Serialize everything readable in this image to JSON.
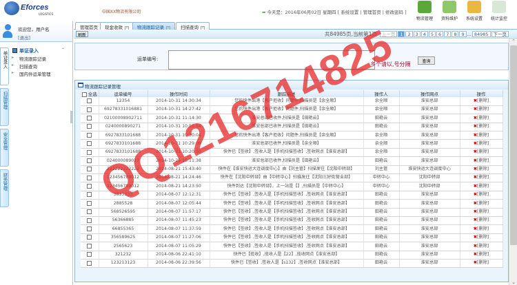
{
  "header": {
    "logo_text": "Eforces",
    "logo_sub": "LOGISTICS",
    "company": "中国XX物流有限公司",
    "date_text": "今天是：2016年06月02日 星期四",
    "links": [
      "系统设置",
      "管理首页",
      "修改密码"
    ],
    "modules": [
      {
        "label": "物流管理",
        "color": "#5aa83a"
      },
      {
        "label": "资料维护",
        "color": "#8fc86a"
      },
      {
        "label": "系统设置",
        "color": "#e8b840"
      },
      {
        "label": "统计监控",
        "color": "#d8e8d8"
      }
    ]
  },
  "user": {
    "welcome": "欢迎您，用户名",
    "logout": "[退出]"
  },
  "vtabs": [
    "单证录入",
    "扫描管理",
    "安全管理",
    "财务管理"
  ],
  "menu": {
    "title": "单证录入",
    "items": [
      "物流跟踪记录",
      "扫描查询",
      "国内件运单管理"
    ]
  },
  "tabs": [
    "管理首页",
    "现金收款",
    "物流跟踪记录",
    "扫描查询"
  ],
  "toolbar": {
    "refresh": "刷新"
  },
  "pager": {
    "info": "共84985页,当前第1页",
    "prev": "上一页",
    "pages": [
      "1",
      "2",
      "3",
      "4",
      "5",
      "6",
      "7",
      "8",
      "9",
      "...",
      "84985"
    ],
    "next": "下一页",
    "current": "1"
  },
  "search": {
    "label": "运单编号:",
    "value": "",
    "hint": "多个请以,号分隔",
    "button": "查询"
  },
  "grid": {
    "title": "物流跟踪记录管理",
    "select_all": "全选",
    "columns": [
      "运单编号",
      "操作时间",
      "跟踪描述",
      "操作人",
      "操作网点",
      "操作"
    ],
    "delete_label": "[删除]",
    "rows": [
      [
        "12354",
        "2014-10-31 14:30:34",
        "您的快件出港【客户拒收】问题件,扫描员是【余全顺】",
        "余全顺",
        "淮安总部"
      ],
      [
        "69278331016881",
        "2014-10-31 14:27:42",
        "您的快件出港【客户拒收】问题件,扫描员是【余全顺】",
        "余全顺",
        "淮安总部"
      ],
      [
        "02100008902711",
        "2014-10-31 11:14:30",
        "淮安总部已收件,扫描员是【田艳云】",
        "田艳云",
        "淮安总部"
      ],
      [
        "0240000890271",
        "2014-10-31 10:55:54",
        "淮安总部已收件,扫描员是【田艳云】",
        "田艳云",
        "淮安总部"
      ],
      [
        "6927833101688",
        "2014-10-31 10:30:04",
        "您的快件出港【客户拒收】问题件,扫描员是【余全顺】",
        "余全顺",
        "淮安总部"
      ],
      [
        "6927833101688",
        "2014-10-31 10:29:09",
        "淮安总部已收件,扫描员是【余全顺】",
        "余全顺",
        "淮安总部"
      ],
      [
        "6927833101688",
        "2014-10-31 10:20:50",
        "快件已【签收】,签收人是【手机扫描签收】,签收网点【淮安总部】",
        "余全顺",
        "淮安总部"
      ],
      [
        "024000089027",
        "2014-10-29 10:11:38",
        "淮安总部已收件,扫描员是【田艳云】",
        "田艳云",
        "淮安总部"
      ],
      [
        "222222222222",
        "2014-08-21 15:43:40",
        "快件在【淮安快运大连调度中心】由【刘主管】扫描发往【沈阳中转部】",
        "刘主管",
        "淮安快运大连调度中心"
      ],
      [
        "123456789012",
        "2014-08-21 14:24:46",
        "快件在【沈阳中转部】由【中转中心】扫描发往【沈阳三好街营业部】",
        "中转中心",
        "沈阳中转部"
      ],
      [
        "123456789012",
        "2014-08-21 14:23:50",
        "快件到达【沈阳中转部】，上一站是【】,扫描员是【中转中心】",
        "中转中心",
        "沈阳中转部"
      ],
      [
        "3833333",
        "2014-08-07 12:12:31",
        "快件已【签收】,签收人是【手机扫描签收】,签收网点【淮安总部】",
        "田艳云",
        "淮安总部"
      ],
      [
        "2885528",
        "2014-08-07 12:05:44",
        "快件已【签收】,签收人是【手机扫描签收】,签收网点【淮安总部】",
        "田艳云",
        "淮安总部"
      ],
      [
        "568526595",
        "2014-08-07 11:57:17",
        "快件已【签收】,签收人是【手机扫描签收】,签收网点【淮安总部】",
        "田艳云",
        "淮安总部"
      ],
      [
        "56366885",
        "2014-08-07 11:45:23",
        "快件已【签收】,签收人是【手机扫描签收】,签收网点【淮安总部】",
        "田艳云",
        "淮安总部"
      ],
      [
        "66855365",
        "2014-08-07 11:37:59",
        "快件已【签收】,签收人是【手机扫描签收】,签收网点【淮安总部】",
        "田艳云",
        "淮安总部"
      ],
      [
        "356589625",
        "2014-08-07 11:27:06",
        "快件已【签收】,签收人是【手机扫描签收】,签收网点【淮安总部】",
        "田艳云",
        "淮安总部"
      ],
      [
        "2565623",
        "2014-08-07 11:05:29",
        "快件已【签收】,签收人是【手机扫描签收】,签收网点【淮安总部】",
        "田艳云",
        "淮安总部"
      ],
      [
        "321232",
        "2014-08-06 22:41:10",
        "快件已【揽收】,揽收人是【22】,揽收网点【淮安总部】",
        "田艳云",
        "淮安总部"
      ],
      [
        "123213123",
        "2014-08-06 22:39:56",
        "快件已【签收】,签收人是【s132】,签收网点【淮安总部】",
        "田艳云",
        "淮安总部"
      ]
    ]
  },
  "watermark": "QQ1216714825"
}
